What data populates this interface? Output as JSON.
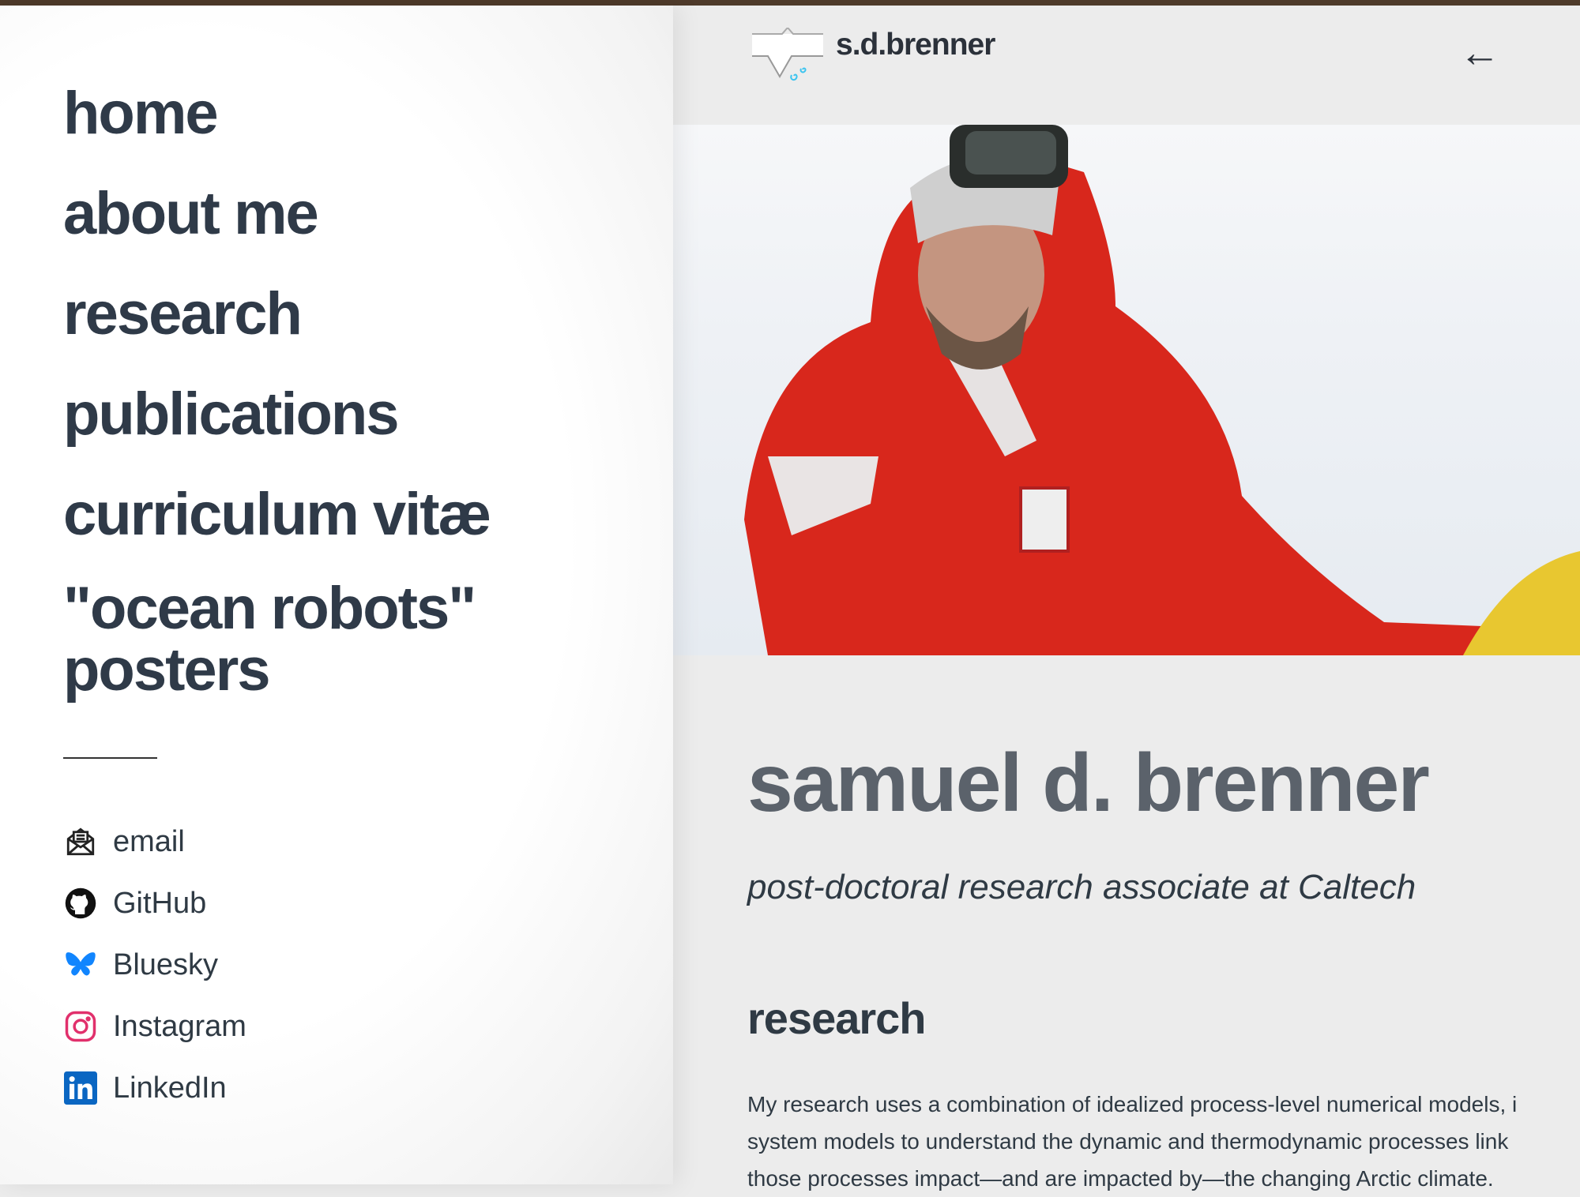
{
  "sidebar": {
    "nav": [
      {
        "label": "home"
      },
      {
        "label": "about me"
      },
      {
        "label": "research"
      },
      {
        "label": "publications"
      },
      {
        "label": "curriculum vitæ"
      },
      {
        "label": "\"ocean robots\" posters"
      }
    ],
    "social": [
      {
        "label": "email",
        "icon": "email-icon"
      },
      {
        "label": "GitHub",
        "icon": "github-icon"
      },
      {
        "label": "Bluesky",
        "icon": "bluesky-icon"
      },
      {
        "label": "Instagram",
        "icon": "instagram-icon"
      },
      {
        "label": "LinkedIn",
        "icon": "linkedin-icon"
      }
    ]
  },
  "header": {
    "brand": "s.d.brenner",
    "back_icon": "arrow-left-icon"
  },
  "main": {
    "name": "samuel d. brenner",
    "subtitle": "post-doctoral research associate at Caltech",
    "research_heading": "research",
    "research_lines": [
      "My research uses a combination of idealized process-level numerical models, i",
      "system models to understand the dynamic and thermodynamic processes link",
      "those processes impact—and are impacted by—the changing Arctic climate."
    ]
  },
  "colors": {
    "topbar": "#4e3a2a",
    "bluesky": "#1185fe",
    "instagram": "#e1306c",
    "linkedin": "#0a66c2",
    "logo_swirl": "#3cc4ef"
  }
}
